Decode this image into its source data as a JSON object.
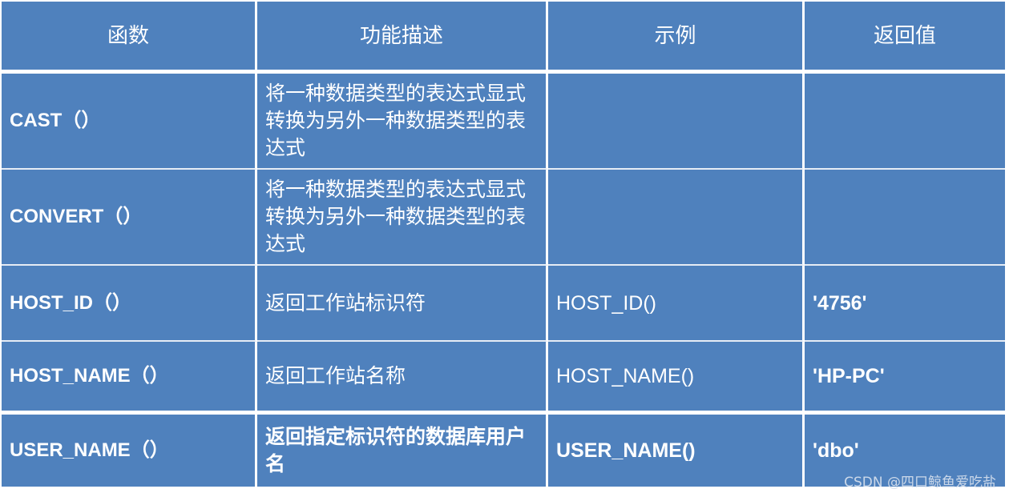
{
  "table": {
    "headers": [
      "函数",
      "功能描述",
      "示例",
      "返回值"
    ],
    "rows": [
      {
        "function": "CAST（）",
        "description": "将一种数据类型的表达式显式转换为另外一种数据类型的表达式",
        "example": "",
        "return_value": ""
      },
      {
        "function": "CONVERT（）",
        "description": "将一种数据类型的表达式显式转换为另外一种数据类型的表达式",
        "example": "",
        "return_value": ""
      },
      {
        "function": "HOST_ID（）",
        "description": "返回工作站标识符",
        "example": "HOST_ID()",
        "return_value": "'4756'"
      },
      {
        "function": "HOST_NAME（）",
        "description": "返回工作站名称",
        "example": "HOST_NAME()",
        "return_value": "'HP-PC'"
      },
      {
        "function": "USER_NAME（）",
        "description": "返回指定标识符的数据库用户名",
        "example": "USER_NAME()",
        "return_value": "'dbo'"
      }
    ]
  },
  "colors": {
    "cell_background": "#4f81bd",
    "text": "#ffffff",
    "grid": "#ffffff"
  },
  "watermark": "CSDN @四口鲸鱼爱吃盐"
}
